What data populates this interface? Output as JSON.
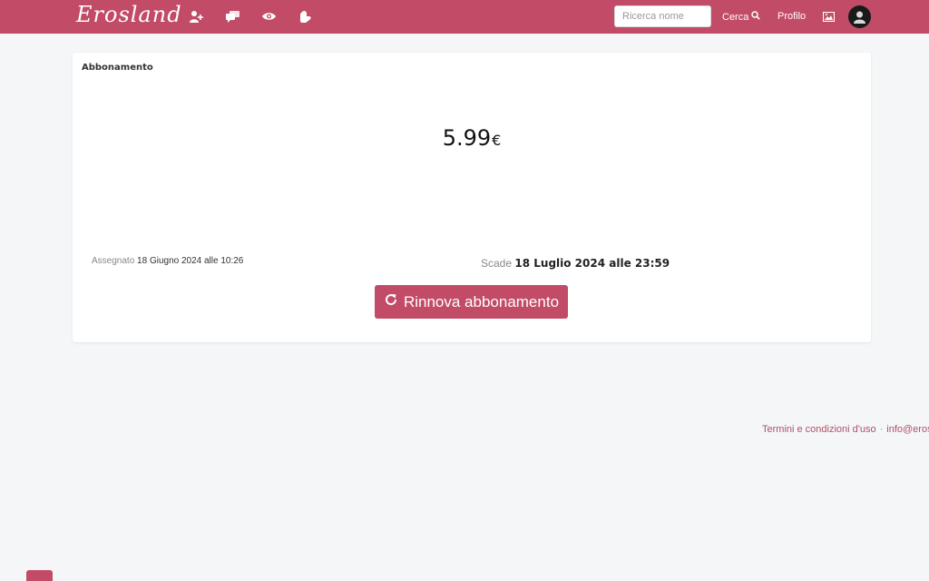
{
  "navbar": {
    "brand": "Erosland",
    "icons": [
      "add-user-icon",
      "messages-icon",
      "eye-icon",
      "heart-hand-icon"
    ],
    "search": {
      "placeholder": "Ricerca nome",
      "value": ""
    },
    "search_label": "Cerca",
    "profile_label": "Profilo",
    "colors": {
      "accent": "#c24b67"
    }
  },
  "subscription": {
    "title": "Abbonamento",
    "price": "5.99",
    "currency": "€",
    "assigned_label": "Assegnato",
    "assigned_value": "18 Giugno 2024 alle 10:26",
    "expires_label": "Scade",
    "expires_value": "18 Luglio 2024 alle 23:59",
    "renew_label": "Rinnova abbonamento"
  },
  "footer": {
    "terms": "Termini e condizioni d'uso",
    "separator": "·",
    "email": "info@erosland"
  }
}
